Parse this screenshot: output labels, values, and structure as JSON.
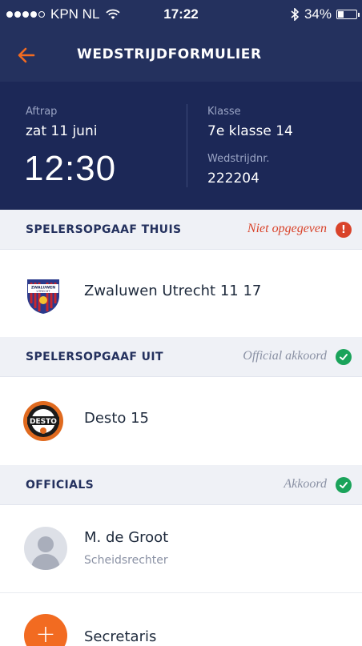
{
  "status_bar": {
    "carrier": "KPN NL",
    "time": "17:22",
    "battery": "34%",
    "battery_level": 0.34,
    "signal_bars": 4,
    "signal_max": 5
  },
  "nav": {
    "title": "WEDSTRIJDFORMULIER",
    "back_icon": "arrow-left-icon"
  },
  "match": {
    "kickoff_label": "Aftrap",
    "date": "zat 11 juni",
    "time": "12:30",
    "class_label": "Klasse",
    "class_value": "7e klasse 14",
    "match_number_label": "Wedstrijdnr.",
    "match_number": "222204"
  },
  "sections": {
    "home": {
      "title": "SPELERSOPGAAF THUIS",
      "status": "Niet opgegeven",
      "status_color": "#d9432a",
      "status_icon": "exclamation-icon",
      "team_name": "Zwaluwen Utrecht 11 17",
      "logo_text": "ZWALUWEN UTRECHT"
    },
    "away": {
      "title": "SPELERSOPGAAF UIT",
      "status": "Official akkoord",
      "status_color": "#8a91a4",
      "status_icon": "check-icon",
      "team_name": "Desto 15",
      "logo_text": "DESTO"
    },
    "officials": {
      "title": "OFFICIALS",
      "status": "Akkoord",
      "status_color": "#8a91a4",
      "status_icon": "check-icon",
      "official_name": "M. de Groot",
      "official_role": "Scheidsrechter",
      "add_label": "Secretaris",
      "add_symbol": "+"
    }
  },
  "colors": {
    "nav_bg": "#24315e",
    "accent": "#f26b21",
    "success": "#1aa35a",
    "error": "#d9432a"
  }
}
